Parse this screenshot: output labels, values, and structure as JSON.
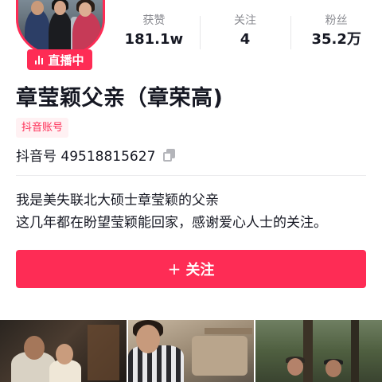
{
  "profile": {
    "live_label": "直播中",
    "name": "章莹颖父亲（章荣高)",
    "account_tag": "抖音账号",
    "douyin_id": "抖音号 49518815627",
    "bio_lines": [
      "我是美失联北大硕士章莹颖的父亲",
      "这几年都在盼望莹颖能回家，感谢爱心人士的关注。"
    ]
  },
  "stats": [
    {
      "label": "获赞",
      "value": "181.1w"
    },
    {
      "label": "关注",
      "value": "4"
    },
    {
      "label": "粉丝",
      "value": "35.2万"
    }
  ],
  "follow_button": {
    "icon": "+",
    "label": "关注"
  },
  "colors": {
    "accent": "#fe2c55",
    "tag_bg": "#fff1f3",
    "text": "#161823",
    "muted": "#8a8b91"
  },
  "icons": [
    "live-bars-icon",
    "copy-icon",
    "plus-icon"
  ]
}
